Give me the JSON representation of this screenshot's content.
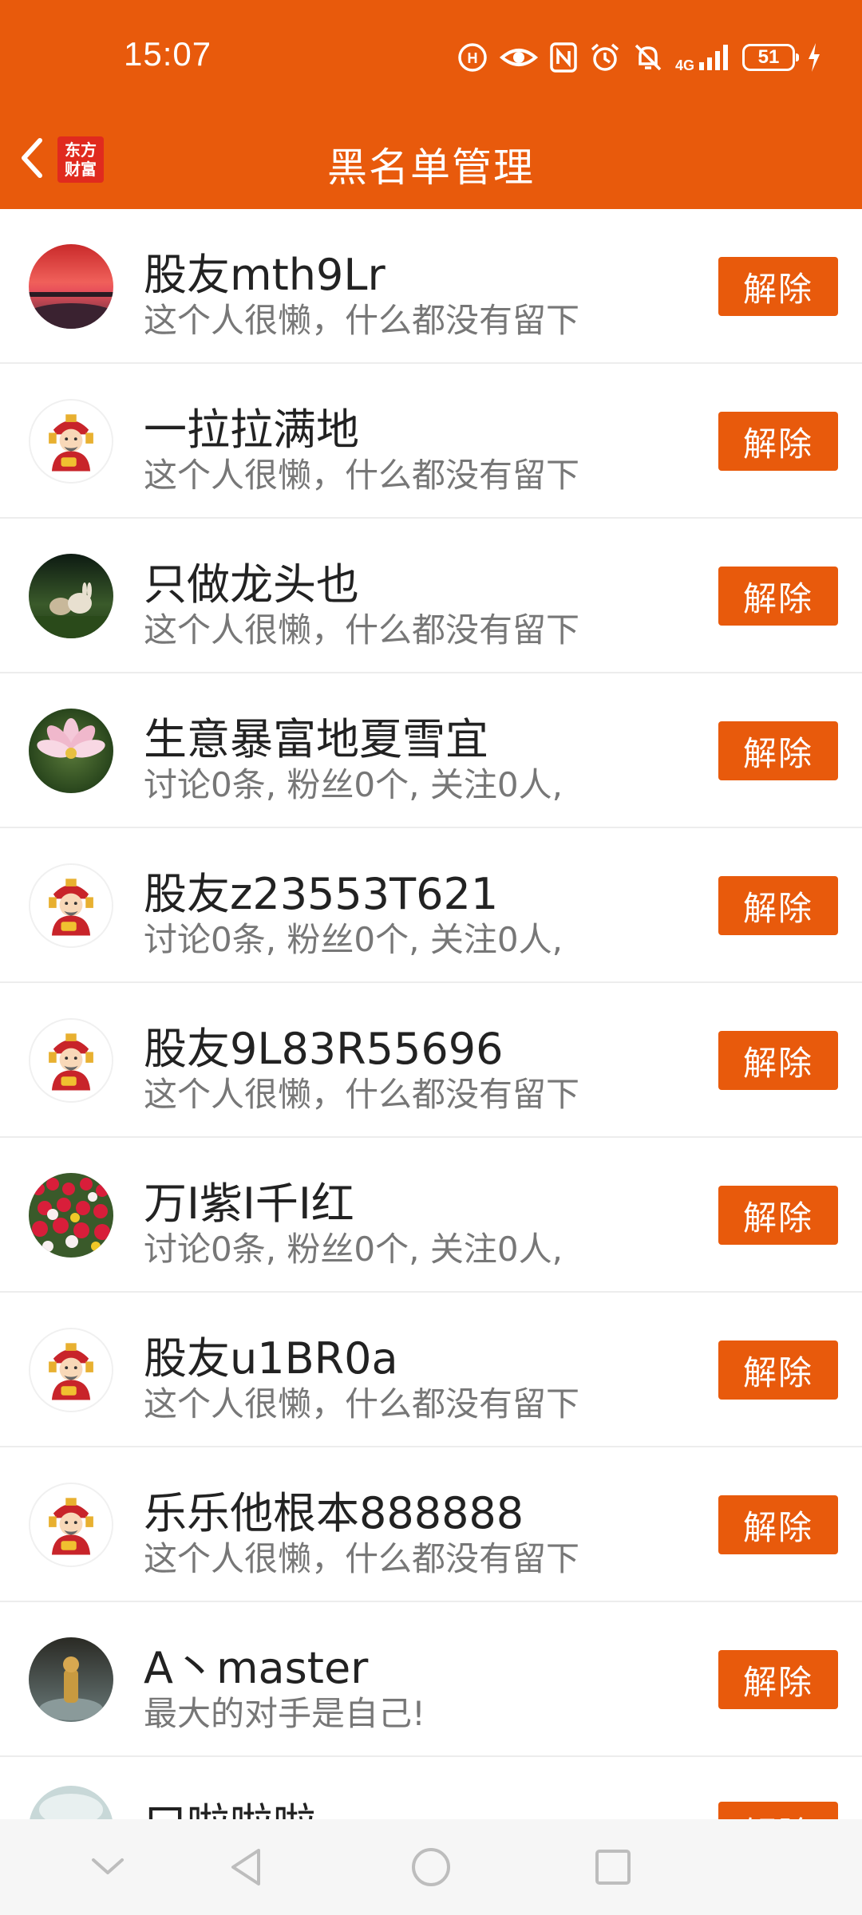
{
  "status_bar": {
    "time": "15:07",
    "battery": "51",
    "network": "4G",
    "icons": [
      "hd-icon",
      "eye-icon",
      "nfc-icon",
      "alarm-icon",
      "mute-icon",
      "signal-icon",
      "battery-icon",
      "charging-icon"
    ]
  },
  "header": {
    "back_icon": "chevron-left-icon",
    "logo_line1": "东方",
    "logo_line2": "财富",
    "title": "黑名单管理"
  },
  "colors": {
    "brand": "#E85A0C",
    "logo_red": "#E02A1E"
  },
  "list": {
    "remove_label": "解除",
    "items": [
      {
        "name": "股友mth9Lr",
        "desc": "这个人很懒，什么都没有留下",
        "avatar": "sunset-photo"
      },
      {
        "name": "一拉拉满地",
        "desc": "这个人很懒，什么都没有留下",
        "avatar": "default-fortune-god"
      },
      {
        "name": "只做龙头也",
        "desc": "这个人很懒，什么都没有留下",
        "avatar": "rabbit-photo"
      },
      {
        "name": "生意暴富地夏雪宜",
        "desc": "讨论0条, 粉丝0个, 关注0人,",
        "avatar": "lotus-photo"
      },
      {
        "name": "股友z23553T621",
        "desc": "讨论0条, 粉丝0个, 关注0人,",
        "avatar": "default-fortune-god"
      },
      {
        "name": "股友9L83R55696",
        "desc": "这个人很懒，什么都没有留下",
        "avatar": "default-fortune-god"
      },
      {
        "name": "万I紫I千I红",
        "desc": "讨论0条, 粉丝0个, 关注0人,",
        "avatar": "tulips-photo"
      },
      {
        "name": "股友u1BR0a",
        "desc": "这个人很懒，什么都没有留下",
        "avatar": "default-fortune-god"
      },
      {
        "name": "乐乐他根本888888",
        "desc": "这个人很懒，什么都没有留下",
        "avatar": "default-fortune-god"
      },
      {
        "name": "A丶master",
        "desc": "最大的对手是自己!",
        "avatar": "figure-photo"
      },
      {
        "name": "口啦啦啦",
        "desc": "",
        "avatar": "light-photo"
      }
    ]
  },
  "system_nav": {
    "icons": [
      "collapse-icon",
      "back-triangle-icon",
      "home-circle-icon",
      "recents-square-icon"
    ]
  }
}
